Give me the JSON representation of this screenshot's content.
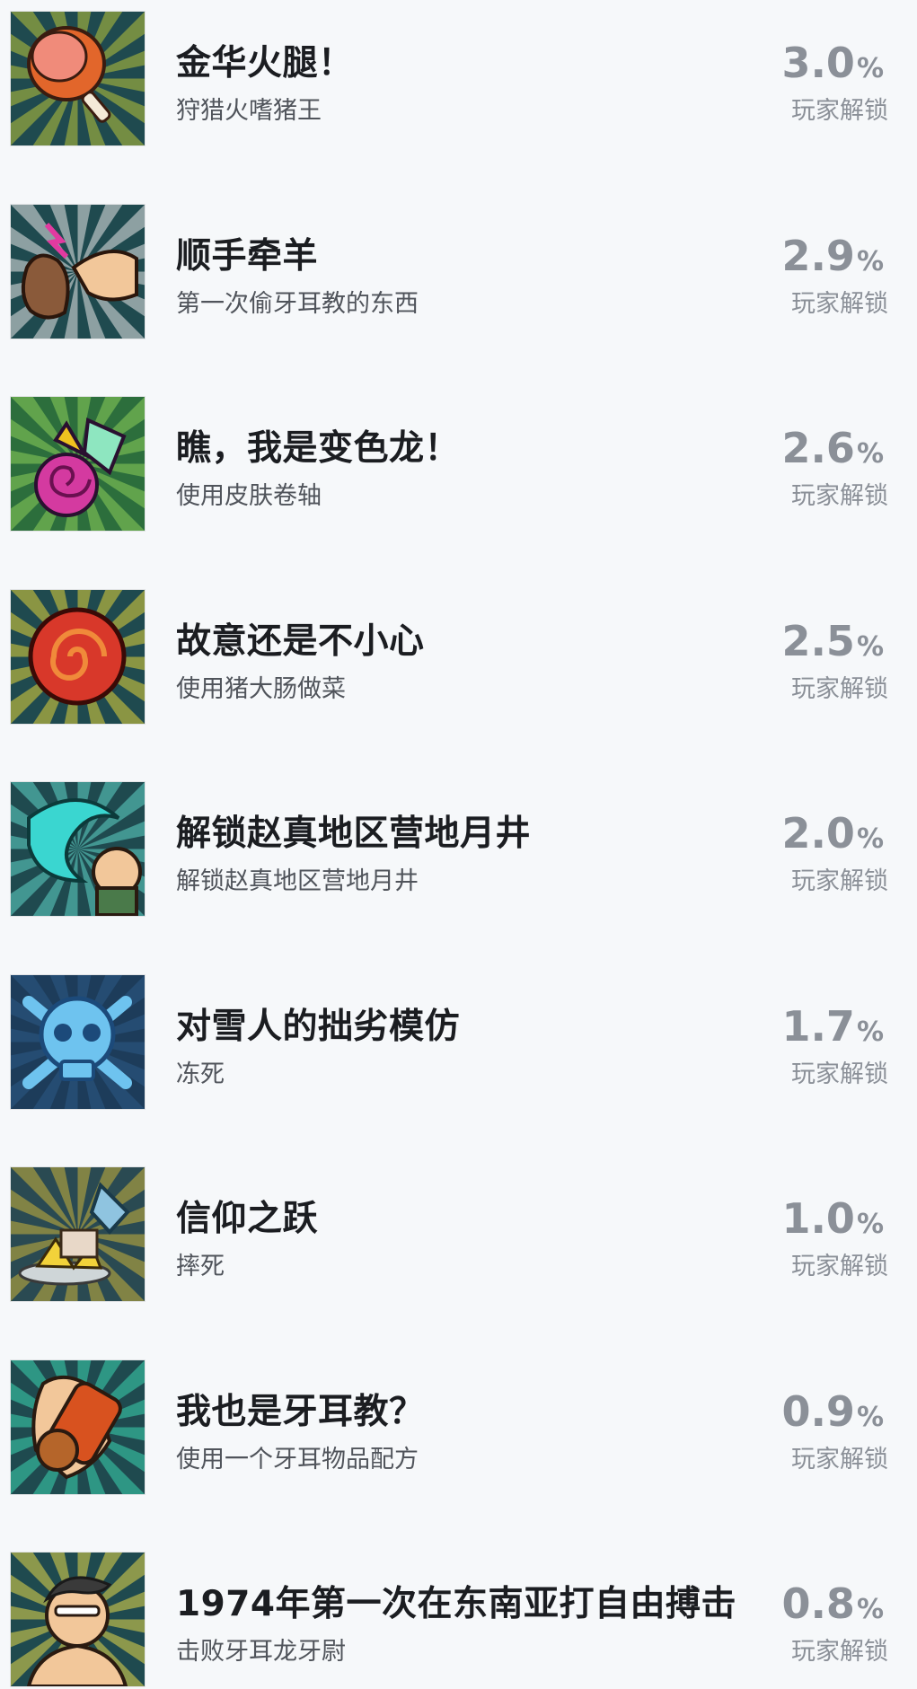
{
  "achievements": [
    {
      "title": "金华火腿！",
      "desc": "狩猎火嗜猪王",
      "percent": "3.0",
      "percent_sign": "%",
      "unlock_label": "玩家解锁",
      "icon": "ham-icon",
      "colors": {
        "bg": "#1f4a4f",
        "rays": "#b9c43a",
        "main": "#e2662b",
        "accent": "#f08b7a"
      }
    },
    {
      "title": "顺手牵羊",
      "desc": "第一次偷牙耳教的东西",
      "percent": "2.9",
      "percent_sign": "%",
      "unlock_label": "玩家解锁",
      "icon": "stealing-hand-icon",
      "colors": {
        "bg": "#1f4a4f",
        "rays": "#e8e8e8",
        "main": "#8a5a3a",
        "accent": "#e23aa0"
      }
    },
    {
      "title": "瞧，我是变色龙！",
      "desc": "使用皮肤卷轴",
      "percent": "2.6",
      "percent_sign": "%",
      "unlock_label": "玩家解锁",
      "icon": "skin-scroll-icon",
      "colors": {
        "bg": "#2c6e3c",
        "rays": "#8ed05a",
        "main": "#d43aa0",
        "accent": "#f0c21f"
      }
    },
    {
      "title": "故意还是不小心",
      "desc": "使用猪大肠做菜",
      "percent": "2.5",
      "percent_sign": "%",
      "unlock_label": "玩家解锁",
      "icon": "intestine-icon",
      "colors": {
        "bg": "#1f4a4f",
        "rays": "#e2d33a",
        "main": "#d8382a",
        "accent": "#f08a3a"
      }
    },
    {
      "title": "解锁赵真地区营地月井",
      "desc": "解锁赵真地区营地月井",
      "percent": "2.0",
      "percent_sign": "%",
      "unlock_label": "玩家解锁",
      "icon": "moonwell-icon",
      "colors": {
        "bg": "#1f4a4f",
        "rays": "#5fd6c8",
        "main": "#3ad6d0",
        "accent": "#f2c79a"
      }
    },
    {
      "title": "对雪人的拙劣模仿",
      "desc": "冻死",
      "percent": "1.7",
      "percent_sign": "%",
      "unlock_label": "玩家解锁",
      "icon": "frozen-skull-icon",
      "colors": {
        "bg": "#1d3c5a",
        "rays": "#2c5a86",
        "main": "#6ec3ef",
        "accent": "#1c4a7a"
      }
    },
    {
      "title": "信仰之跃",
      "desc": "摔死",
      "percent": "1.0",
      "percent_sign": "%",
      "unlock_label": "玩家解锁",
      "icon": "fall-icon",
      "colors": {
        "bg": "#2a4a52",
        "rays": "#c8b23a",
        "main": "#8fc4e0",
        "accent": "#f2d23a"
      }
    },
    {
      "title": "我也是牙耳教？",
      "desc": "使用一个牙耳物品配方",
      "percent": "0.9",
      "percent_sign": "%",
      "unlock_label": "玩家解锁",
      "icon": "recipe-scroll-icon",
      "colors": {
        "bg": "#1f4a4f",
        "rays": "#3ad6b0",
        "main": "#d8521f",
        "accent": "#f2c79a"
      }
    },
    {
      "title": "1974年第一次在东南亚打自由搏击",
      "desc": "击败牙耳龙牙尉",
      "percent": "0.8",
      "percent_sign": "%",
      "unlock_label": "玩家解锁",
      "icon": "fighter-icon",
      "colors": {
        "bg": "#1f4a4f",
        "rays": "#e6d84a",
        "main": "#f2c79a",
        "accent": "#3a3a3a"
      }
    }
  ]
}
